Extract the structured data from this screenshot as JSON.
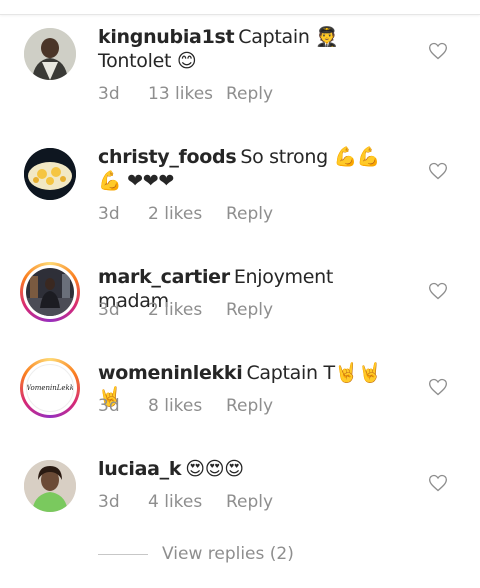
{
  "comments": [
    {
      "username": "kingnubia1st",
      "text": "Captain 🧑‍✈️ Tontolet 😊",
      "time": "3d",
      "likes": "13 likes",
      "reply_label": "Reply",
      "story_ring": false,
      "avatar_color": "#5a5a4a"
    },
    {
      "username": "christy_foods",
      "text": "So strong 💪💪💪 ❤❤❤",
      "time": "3d",
      "likes": "2 likes",
      "reply_label": "Reply",
      "story_ring": false,
      "avatar_color": "#1a2a3a"
    },
    {
      "username": "mark_cartier",
      "text": "Enjoyment madam",
      "time": "3d",
      "likes": "2 likes",
      "reply_label": "Reply",
      "story_ring": true,
      "avatar_color": "#3a3a40"
    },
    {
      "username": "womeninlekki",
      "text": "Captain T🤘🤘🤘",
      "time": "3d",
      "likes": "8 likes",
      "reply_label": "Reply",
      "story_ring": true,
      "avatar_color": "#ffffff",
      "avatar_text": "WomeninLekki"
    },
    {
      "username": "luciaa_k",
      "text": "😍😍😍",
      "time": "3d",
      "likes": "4 likes",
      "reply_label": "Reply",
      "story_ring": false,
      "avatar_color": "#7ac95e"
    }
  ],
  "view_replies": "View replies (2)",
  "colors": {
    "text": "#262626",
    "meta": "#8e8e8e",
    "heart": "#8e8e8e"
  }
}
